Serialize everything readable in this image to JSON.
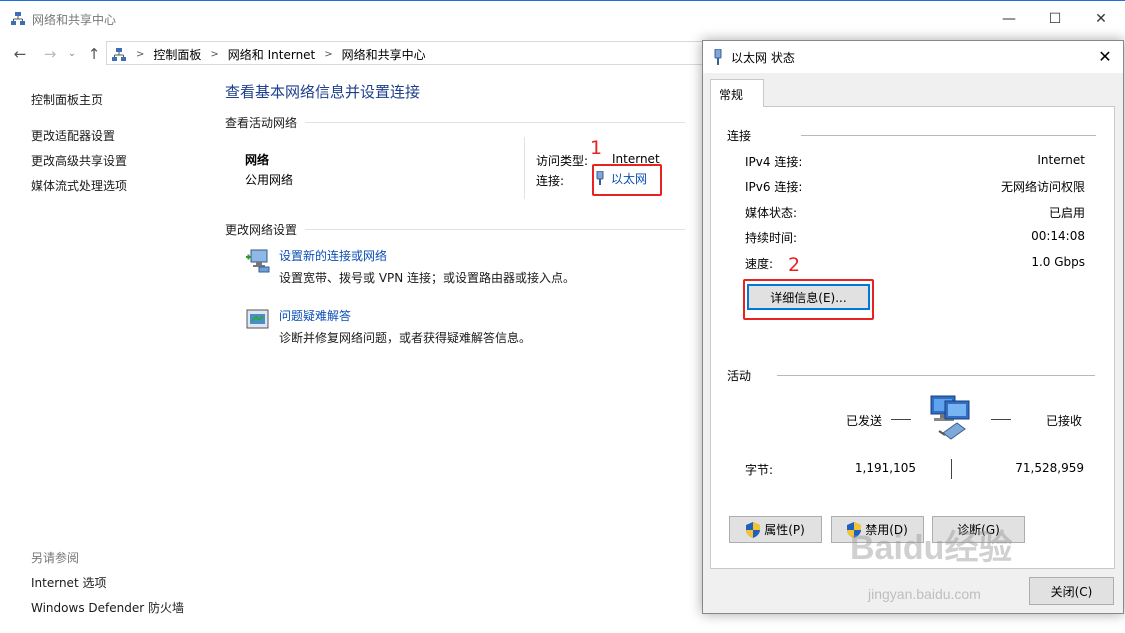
{
  "main_window": {
    "title": "网络和共享中心",
    "controls": {
      "minimize": "—",
      "maximize": "☐",
      "close": "✕"
    }
  },
  "address_bar": {
    "breadcrumbs": [
      "控制面板",
      "网络和 Internet",
      "网络和共享中心"
    ]
  },
  "sidebar": {
    "home": "控制面板主页",
    "links": [
      "更改适配器设置",
      "更改高级共享设置",
      "媒体流式处理选项"
    ],
    "see_also_header": "另请参阅",
    "see_also": [
      "Internet 选项",
      "Windows Defender 防火墙"
    ]
  },
  "main": {
    "title": "查看基本网络信息并设置连接",
    "active_networks_header": "查看活动网络",
    "network_name": "网络",
    "network_type": "公用网络",
    "access_type_label": "访问类型:",
    "access_type_value": "Internet",
    "connection_label": "连接:",
    "connection_link": "以太网",
    "change_settings_header": "更改网络设置",
    "tasks": [
      {
        "link": "设置新的连接或网络",
        "desc": "设置宽带、拨号或 VPN 连接；或设置路由器或接入点。",
        "icon": "new-connection-icon"
      },
      {
        "link": "问题疑难解答",
        "desc": "诊断并修复网络问题，或者获得疑难解答信息。",
        "icon": "troubleshoot-icon"
      }
    ]
  },
  "annotations": {
    "step1": "1",
    "step2": "2",
    "color": "#e8231f"
  },
  "dialog": {
    "title": "以太网 状态",
    "tab": "常规",
    "connection_group": "连接",
    "properties": [
      {
        "label": "IPv4 连接:",
        "value": "Internet"
      },
      {
        "label": "IPv6 连接:",
        "value": "无网络访问权限"
      },
      {
        "label": "媒体状态:",
        "value": "已启用"
      },
      {
        "label": "持续时间:",
        "value": "00:14:08"
      },
      {
        "label": "速度:",
        "value": "1.0 Gbps"
      }
    ],
    "details_button": "详细信息(E)...",
    "activity_group": "活动",
    "sent_label": "已发送",
    "received_label": "已接收",
    "bytes_label": "字节:",
    "bytes_sent": "1,191,105",
    "bytes_received": "71,528,959",
    "buttons": {
      "properties": "属性(P)",
      "disable": "禁用(D)",
      "diagnose": "诊断(G)",
      "close": "关闭(C)"
    }
  },
  "watermark": {
    "brand": "Baidu经验",
    "url": "jingyan.baidu.com"
  }
}
